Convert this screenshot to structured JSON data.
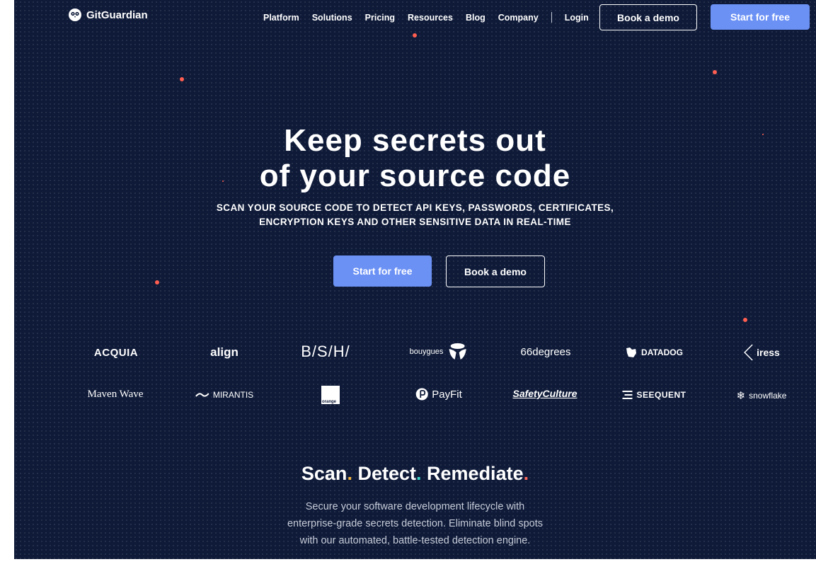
{
  "brand": {
    "name": "GitGuardian",
    "icon": "owl-icon"
  },
  "nav": {
    "links": [
      "Platform",
      "Solutions",
      "Pricing",
      "Resources",
      "Blog",
      "Company"
    ],
    "login": "Login",
    "book_demo": "Book a demo",
    "start_free": "Start for free"
  },
  "hero": {
    "title_line1": "Keep secrets out",
    "title_line2": "of your source code",
    "subtitle_line1": "SCAN YOUR SOURCE CODE TO DETECT API KEYS, PASSWORDS, CERTIFICATES,",
    "subtitle_line2": "ENCRYPTION KEYS AND OTHER SENSITIVE DATA IN REAL-TIME",
    "start_free": "Start for free",
    "book_demo": "Book a demo"
  },
  "customers": {
    "row1": [
      "ACQUIA",
      "align",
      "B/S/H/",
      "bouygues",
      "66degrees",
      "DATADOG",
      "iress"
    ],
    "row2": [
      "Maven Wave",
      "MIRANTIS",
      "orange",
      "PayFit",
      "SafetyCulture",
      "SEEQUENT",
      "snowflake"
    ]
  },
  "section": {
    "title_scan": "Scan",
    "title_detect": "Detect",
    "title_remediate": "Remediate",
    "dot": ".",
    "body_line1": "Secure your software development lifecycle with",
    "body_line2": "enterprise-grade secrets detection. Eliminate blind spots",
    "body_line3": "with our automated, battle-tested detection engine."
  },
  "colors": {
    "background": "#0e1a38",
    "primary": "#6b91f5",
    "accent_red": "#ff5e51",
    "accent_yellow": "#f6b53d",
    "accent_teal": "#3ad6c8"
  }
}
